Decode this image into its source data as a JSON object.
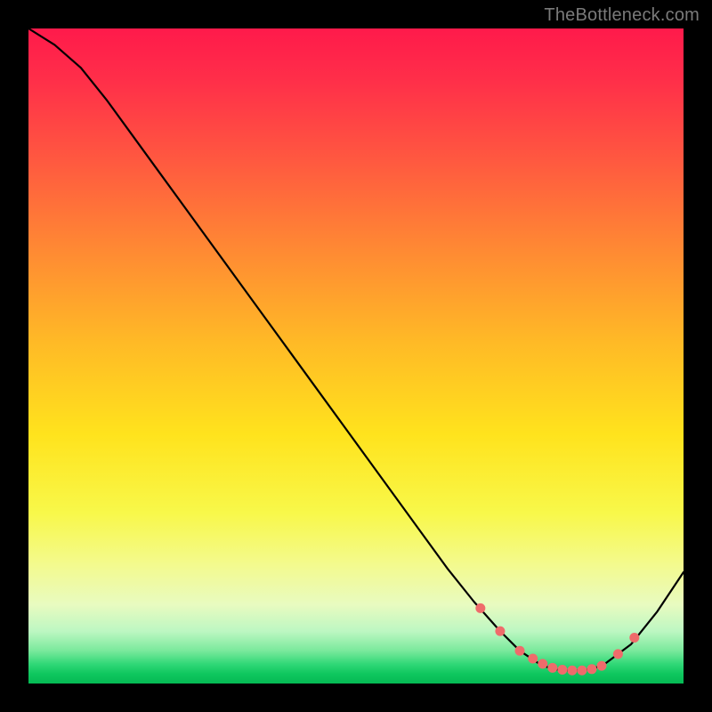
{
  "watermark": {
    "text": "TheBottleneck.com"
  },
  "chart_data": {
    "type": "line",
    "title": "",
    "xlabel": "",
    "ylabel": "",
    "xlim": [
      0,
      100
    ],
    "ylim": [
      0,
      100
    ],
    "grid": false,
    "curve": {
      "x": [
        0,
        4,
        8,
        12,
        16,
        20,
        24,
        28,
        32,
        36,
        40,
        44,
        48,
        52,
        56,
        60,
        64,
        68,
        72,
        75,
        78,
        80,
        82,
        84,
        86,
        88,
        92,
        96,
        100
      ],
      "y": [
        100,
        97.5,
        94,
        89,
        83.5,
        78,
        72.5,
        67,
        61.5,
        56,
        50.5,
        45,
        39.5,
        34,
        28.5,
        23,
        17.5,
        12.5,
        8,
        5,
        3,
        2.2,
        2,
        2,
        2.2,
        3,
        6,
        11,
        17
      ]
    },
    "markers": {
      "x": [
        69,
        72,
        75,
        77,
        78.5,
        80,
        81.5,
        83,
        84.5,
        86,
        87.5,
        90,
        92.5
      ],
      "y": [
        11.5,
        8,
        5,
        3.8,
        3,
        2.4,
        2.1,
        2,
        2,
        2.2,
        2.7,
        4.5,
        7
      ]
    },
    "gradient_note": "red-at-top to green-at-bottom vertical gradient background"
  }
}
